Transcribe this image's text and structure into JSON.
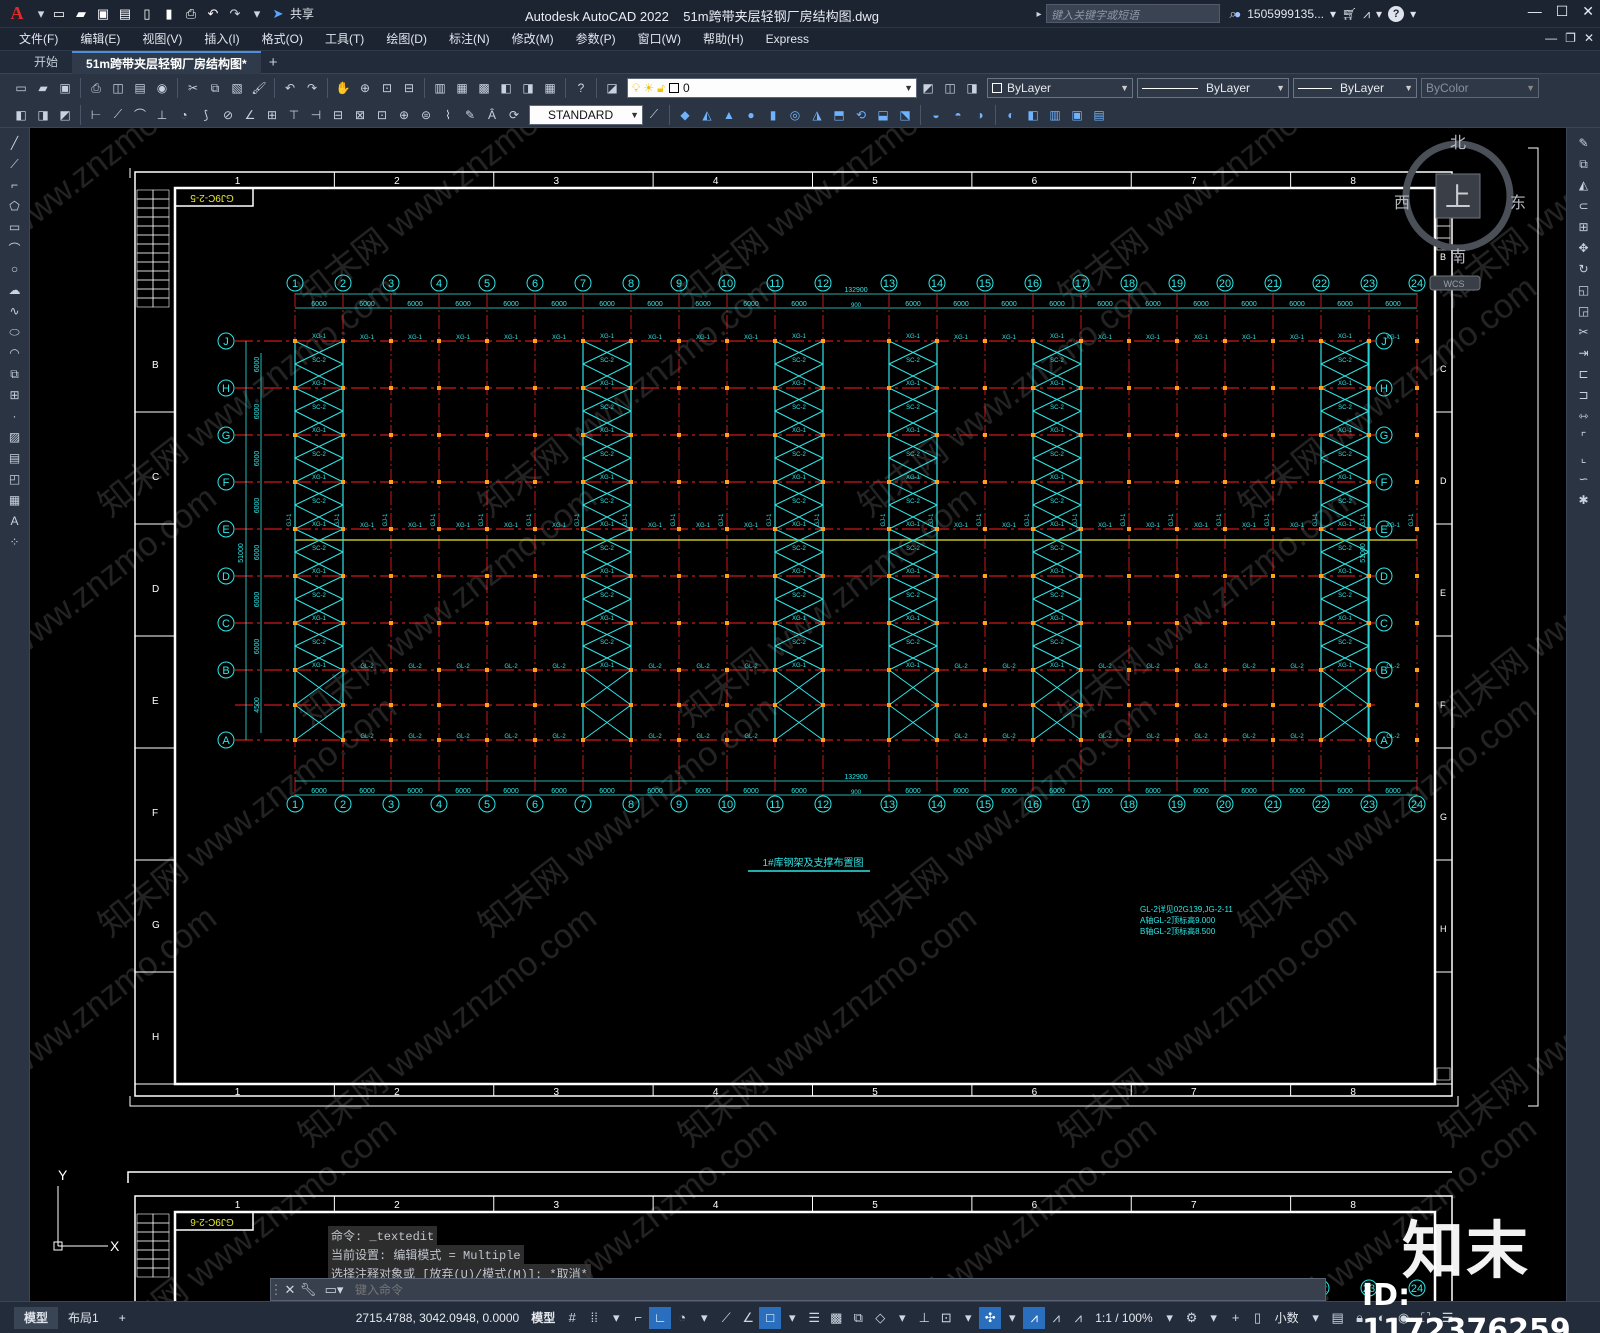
{
  "app": {
    "title": "Autodesk AutoCAD 2022",
    "file": "51m跨带夹层轻钢厂房结构图.dwg"
  },
  "titlebar": {
    "share": "共享",
    "search_placeholder": "键入关键字或短语",
    "user": "1505999135...",
    "help": "?"
  },
  "menu": [
    "文件(F)",
    "编辑(E)",
    "视图(V)",
    "插入(I)",
    "格式(O)",
    "工具(T)",
    "绘图(D)",
    "标注(N)",
    "修改(M)",
    "参数(P)",
    "窗口(W)",
    "帮助(H)",
    "Express"
  ],
  "tabs": [
    {
      "label": "开始",
      "active": false
    },
    {
      "label": "51m跨带夹层轻钢厂房结构图*",
      "active": true
    }
  ],
  "toolbar": {
    "layer": "0",
    "color": "ByLayer",
    "linetype": "ByLayer",
    "lineweight": "ByLayer",
    "plotstyle": "ByColor",
    "textstyle": "STANDARD"
  },
  "viewcube": {
    "north": "北",
    "south": "南",
    "east": "东",
    "west": "西",
    "top": "上",
    "wcs": "WCS"
  },
  "drawing": {
    "border_cols": [
      "1",
      "2",
      "3",
      "4",
      "5",
      "6",
      "7",
      "8"
    ],
    "border_rows": [
      "B",
      "C",
      "D",
      "E",
      "F",
      "G",
      "H"
    ],
    "title_block_code": "GJ9C-2-5",
    "title_block_code2": "GJ9C-2-6",
    "column_axes": [
      "1",
      "2",
      "3",
      "4",
      "5",
      "6",
      "7",
      "8",
      "9",
      "10",
      "11",
      "12",
      "13",
      "14",
      "15",
      "16",
      "17",
      "18",
      "19",
      "20",
      "21",
      "22",
      "23",
      "24"
    ],
    "row_axes": [
      "J",
      "H",
      "G",
      "F",
      "E",
      "D",
      "C",
      "B",
      "A"
    ],
    "bay_dim": "6000",
    "total_length": "132900",
    "joint_gap": "900",
    "row_dims": [
      "6000",
      "6000",
      "6000",
      "6000",
      "6000",
      "6000",
      "6000",
      "4500",
      "4500"
    ],
    "total_width": "51000",
    "drawing_title": "1#库钢架及支撑布置图",
    "notes": [
      "GL-2详见02G139,JG-2-11",
      "A轴GL-2顶标高9.000",
      "B轴GL-2顶标高8.500"
    ],
    "member_labels": {
      "tie": "XG-1",
      "brace": "SC-2",
      "beam": "GL-2",
      "column": "GJ-1",
      "zc": "ZC-2"
    }
  },
  "command": {
    "history": [
      "命令: _textedit",
      "当前设置: 编辑模式 = Multiple",
      "选择注释对象或 [放弃(U)/模式(M)]: *取消*"
    ],
    "placeholder": "键入命令"
  },
  "status": {
    "layout_tabs": [
      {
        "label": "模型",
        "active": true
      },
      {
        "label": "布局1",
        "active": false
      }
    ],
    "coords": "2715.4788, 3042.0948, 0.0000",
    "space": "模型",
    "scale": "1:1 / 100%",
    "units": "小数"
  },
  "watermark": {
    "logo": "知末",
    "id": "ID: 1172376259",
    "site": "知末网 www.znzmo.com"
  },
  "colors": {
    "axis": "#2fe6e6",
    "grid_red": "#ff2020",
    "yellow": "#e8e82a",
    "frame": "#ffffff",
    "accent": "#2a6fbd"
  }
}
